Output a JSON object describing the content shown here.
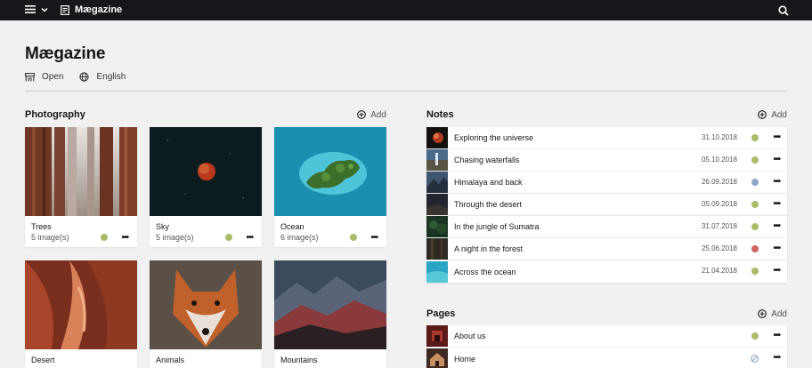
{
  "topbar": {
    "site_name": "Mægazine"
  },
  "page": {
    "title": "Mægazine",
    "status": "Open",
    "language": "English"
  },
  "photography": {
    "title": "Photography",
    "add_label": "Add",
    "albums": [
      {
        "title": "Trees",
        "count": "5 image(s)",
        "status_color": "#a7bd68"
      },
      {
        "title": "Sky",
        "count": "5 image(s)",
        "status_color": "#a7bd68"
      },
      {
        "title": "Ocean",
        "count": "6 image(s)",
        "status_color": "#a7bd68"
      },
      {
        "title": "Desert"
      },
      {
        "title": "Animals"
      },
      {
        "title": "Mountains"
      }
    ]
  },
  "notes": {
    "title": "Notes",
    "add_label": "Add",
    "items": [
      {
        "title": "Exploring the universe",
        "date": "31.10.2018",
        "status_color": "#a7bd68"
      },
      {
        "title": "Chasing waterfalls",
        "date": "05.10.2018",
        "status_color": "#a7bd68"
      },
      {
        "title": "Himalaya and back",
        "date": "26.09.2018",
        "status_color": "#8fa8c8"
      },
      {
        "title": "Through the desert",
        "date": "05.09.2018",
        "status_color": "#a7bd68"
      },
      {
        "title": "In the jungle of Sumatra",
        "date": "31.07.2018",
        "status_color": "#a7bd68"
      },
      {
        "title": "A night in the forest",
        "date": "25.06.2018",
        "status_color": "#d16464"
      },
      {
        "title": "Across the ocean",
        "date": "21.04.2018",
        "status_color": "#a7bd68"
      }
    ]
  },
  "pages": {
    "title": "Pages",
    "add_label": "Add",
    "items": [
      {
        "title": "About us",
        "status_color": "#a7bd68"
      },
      {
        "title": "Home",
        "status_icon": "unlisted-icon"
      }
    ]
  }
}
